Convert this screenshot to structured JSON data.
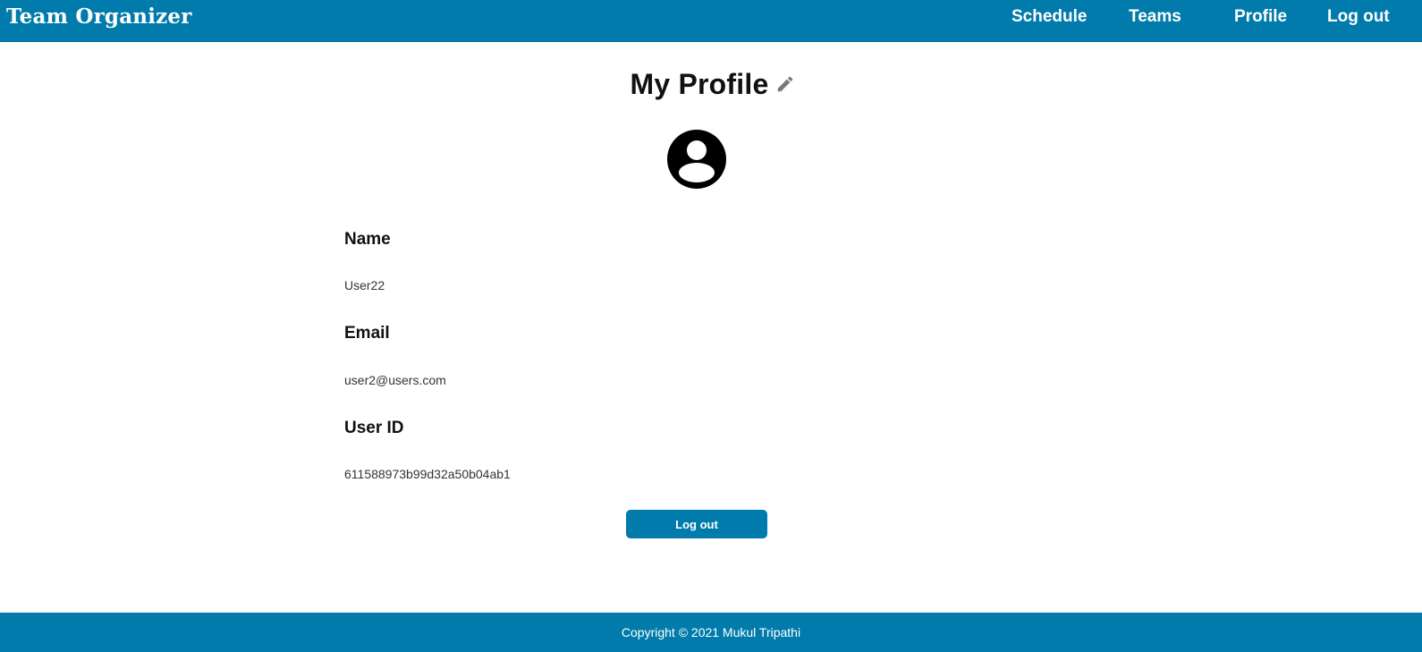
{
  "navbar": {
    "brand": "Team Organizer",
    "links": [
      {
        "label": "Schedule"
      },
      {
        "label": "Teams"
      },
      {
        "label": "Profile"
      },
      {
        "label": "Log out"
      }
    ]
  },
  "profile": {
    "title": "My Profile",
    "edit_icon": "pencil-icon",
    "avatar_icon": "account-circle-icon",
    "fields": [
      {
        "label": "Name",
        "value": "User22"
      },
      {
        "label": "Email",
        "value": "user2@users.com"
      },
      {
        "label": "User ID",
        "value": "611588973b99d32a50b04ab1"
      }
    ],
    "logout_label": "Log out"
  },
  "footer": {
    "text": "Copyright © 2021 Mukul Tripathi"
  },
  "colors": {
    "primary": "#017bab",
    "background": "#ffffff",
    "text": "#111111"
  }
}
